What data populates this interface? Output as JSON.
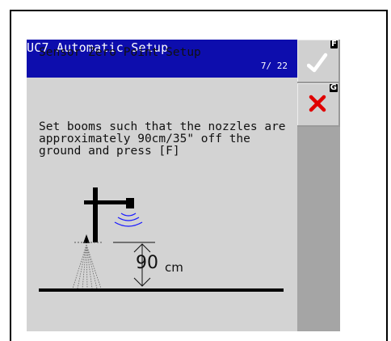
{
  "header": {
    "title": "UC7 Automatic Setup",
    "page": "7/ 22"
  },
  "content": {
    "subtitle": "Sensor Zero Point Setup",
    "instructions": "Set booms such that the nozzles are approximately 90cm/35\" off the ground and press [F]"
  },
  "diagram": {
    "height_value": "90",
    "height_unit": "cm"
  },
  "softkeys": {
    "confirm": {
      "letter": "F",
      "icon": "check-icon"
    },
    "cancel": {
      "letter": "G",
      "icon": "close-icon"
    }
  },
  "colors": {
    "header_bg": "#0d0dad",
    "screen_bg": "#d3d3d3",
    "softkey_bar": "#a5a5a5",
    "cancel_red": "#e00000",
    "sonar_blue": "#1a1aff"
  }
}
